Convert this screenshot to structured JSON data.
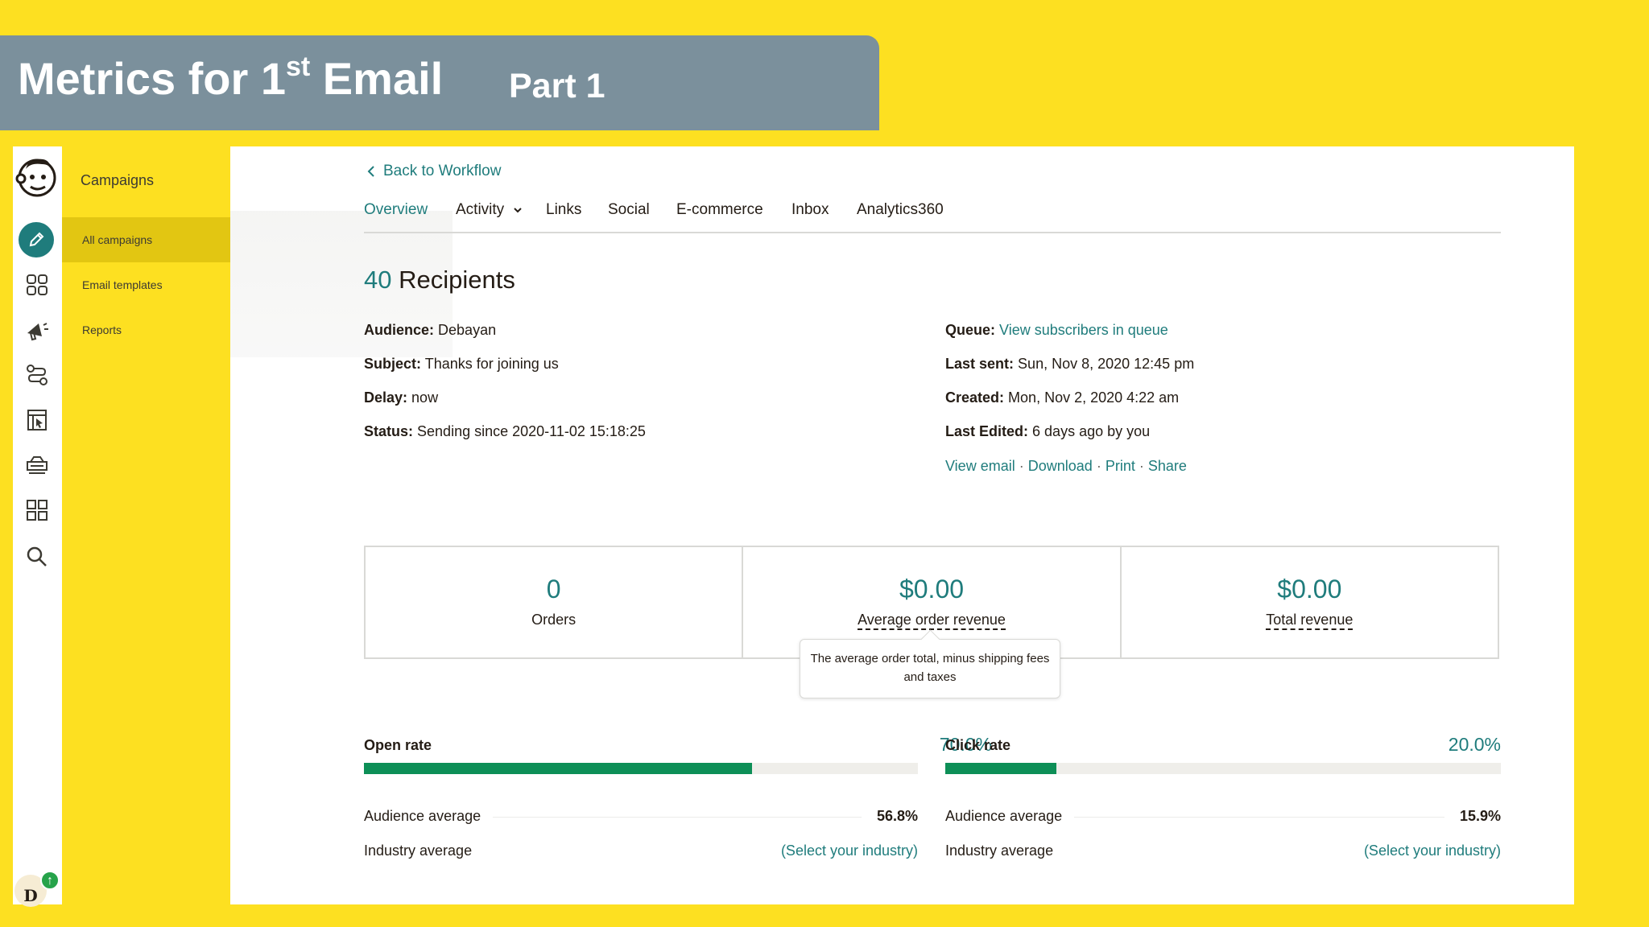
{
  "slide": {
    "title_main": "Metrics for 1",
    "title_sup": "st",
    "title_end": " Email",
    "subtitle": "Part 1"
  },
  "colors": {
    "background": "#fde021",
    "banner": "#7b909c",
    "accent_teal": "#1f7c7c",
    "bar_green": "#0d8f57",
    "badge_green": "#26a34a"
  },
  "rail": {
    "icons": [
      "mailchimp-logo",
      "pencil-icon",
      "audience-icon",
      "megaphone-icon",
      "automation-icon",
      "website-icon",
      "content-icon",
      "integrations-grid-icon",
      "search-icon"
    ],
    "avatar_initial": "D",
    "avatar_badge": "↑"
  },
  "sidebar": {
    "title": "Campaigns",
    "items": [
      {
        "label": "All campaigns",
        "active": true
      },
      {
        "label": "Email templates",
        "active": false
      },
      {
        "label": "Reports",
        "active": false
      }
    ]
  },
  "main": {
    "back_label": "Back to Workflow",
    "tabs": [
      {
        "label": "Overview",
        "active": true
      },
      {
        "label": "Activity",
        "active": false,
        "has_dropdown": true
      },
      {
        "label": "Links",
        "active": false
      },
      {
        "label": "Social",
        "active": false
      },
      {
        "label": "E-commerce",
        "active": false
      },
      {
        "label": "Inbox",
        "active": false
      },
      {
        "label": "Analytics360",
        "active": false
      }
    ],
    "recipients_count": "40",
    "recipients_label": "Recipients",
    "details_left": [
      {
        "label": "Audience:",
        "value": "Debayan"
      },
      {
        "label": "Subject:",
        "value": "Thanks for joining us"
      },
      {
        "label": "Delay:",
        "value": "now"
      },
      {
        "label": "Status:",
        "value": "Sending since 2020-11-02 15:18:25"
      }
    ],
    "details_right": [
      {
        "label": "Queue:",
        "value": "View subscribers in queue"
      },
      {
        "label": "Last sent:",
        "value": "Sun, Nov 8, 2020 12:45 pm"
      },
      {
        "label": "Created:",
        "value": "Mon, Nov 2, 2020 4:22 am"
      },
      {
        "label": "Last Edited:",
        "value": "6 days ago by you"
      }
    ],
    "actions": [
      "View email",
      "Download",
      "Print",
      "Share"
    ],
    "action_separator": "·",
    "stats": [
      {
        "value": "0",
        "label": "Orders"
      },
      {
        "value": "$0.00",
        "label": "Average order revenue"
      },
      {
        "value": "$0.00",
        "label": "Total revenue"
      }
    ],
    "tooltip": "The average order total, minus shipping fees and taxes",
    "rates": [
      {
        "label": "Open rate",
        "value": "70.0%",
        "fraction": 0.7,
        "audience_label": "Audience average",
        "audience_value": "56.8%",
        "industry_label": "Industry average",
        "industry_value": "(Select your industry)"
      },
      {
        "label": "Click rate",
        "value": "20.0%",
        "fraction": 0.2,
        "audience_label": "Audience average",
        "audience_value": "15.9%",
        "industry_label": "Industry average",
        "industry_value": "(Select your industry)"
      }
    ]
  }
}
